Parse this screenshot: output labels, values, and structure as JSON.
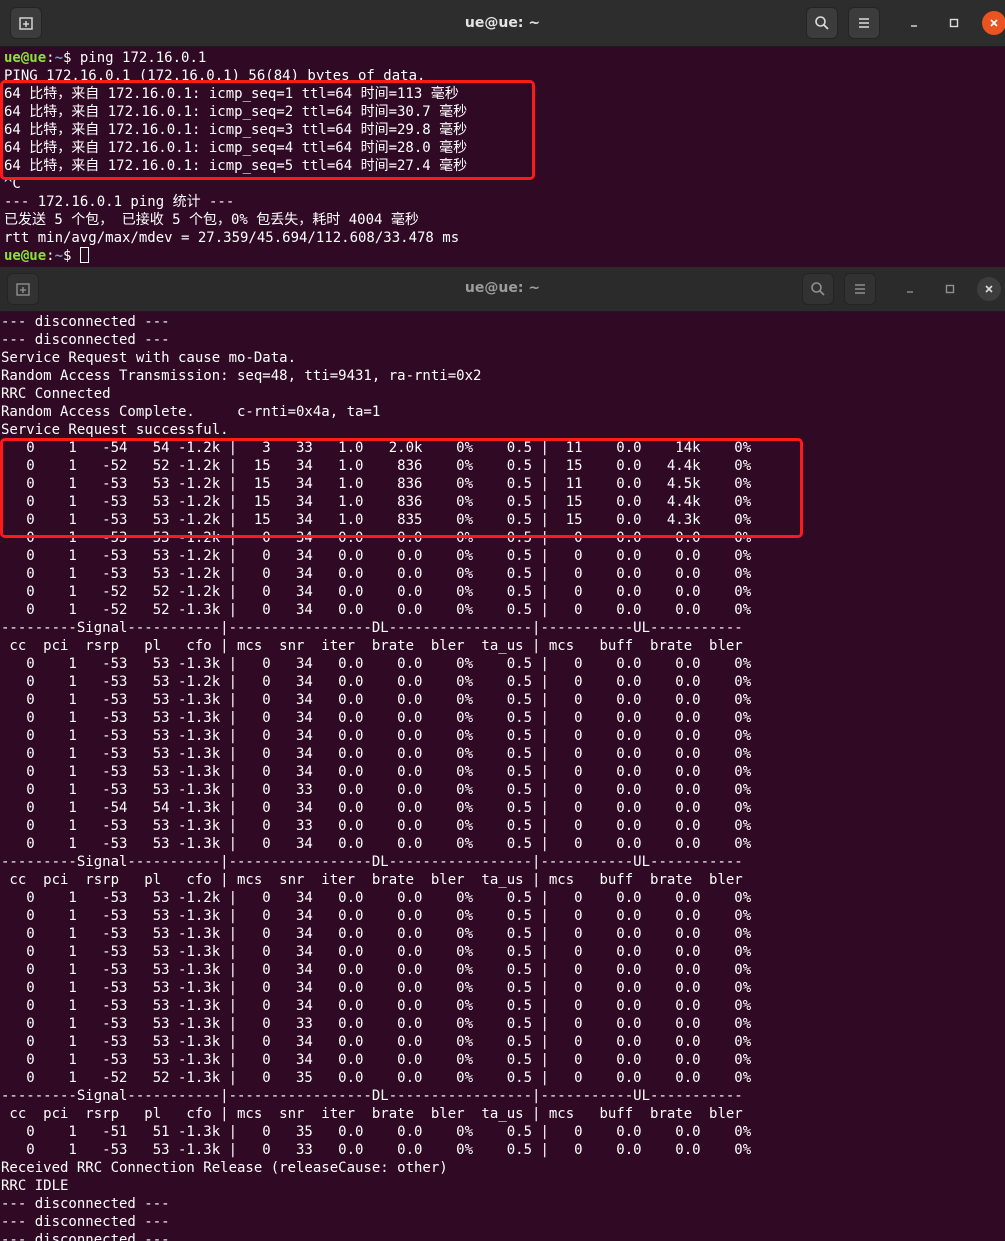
{
  "window1": {
    "title": "ue@ue: ~",
    "prompt_user": "ue@ue",
    "prompt_sep": ":",
    "prompt_path": "~",
    "prompt_dollar": "$ ",
    "command": "ping 172.16.0.1",
    "lines": [
      "PING 172.16.0.1 (172.16.0.1) 56(84) bytes of data.",
      "64 比特，来自 172.16.0.1: icmp_seq=1 ttl=64 时间=113 毫秒",
      "64 比特，来自 172.16.0.1: icmp_seq=2 ttl=64 时间=30.7 毫秒",
      "64 比特，来自 172.16.0.1: icmp_seq=3 ttl=64 时间=29.8 毫秒",
      "64 比特，来自 172.16.0.1: icmp_seq=4 ttl=64 时间=28.0 毫秒",
      "64 比特，来自 172.16.0.1: icmp_seq=5 ttl=64 时间=27.4 毫秒",
      "^C",
      "--- 172.16.0.1 ping 统计 ---",
      "已发送 5 个包， 已接收 5 个包，0% 包丢失，耗时 4004 毫秒",
      "rtt min/avg/max/mdev = 27.359/45.694/112.608/33.478 ms"
    ]
  },
  "window2": {
    "title": "ue@ue: ~",
    "lines": [
      "--- disconnected ---",
      "--- disconnected ---",
      "Service Request with cause mo-Data.",
      "Random Access Transmission: seq=48, tti=9431, ra-rnti=0x2",
      "RRC Connected",
      "Random Access Complete.     c-rnti=0x4a, ta=1",
      "Service Request successful.",
      "   0    1   -54   54 -1.2k |   3   33   1.0   2.0k    0%    0.5 |  11    0.0    14k    0%",
      "   0    1   -52   52 -1.2k |  15   34   1.0    836    0%    0.5 |  15    0.0   4.4k    0%",
      "   0    1   -53   53 -1.2k |  15   34   1.0    836    0%    0.5 |  11    0.0   4.5k    0%",
      "   0    1   -53   53 -1.2k |  15   34   1.0    836    0%    0.5 |  15    0.0   4.4k    0%",
      "   0    1   -53   53 -1.2k |  15   34   1.0    835    0%    0.5 |  15    0.0   4.3k    0%",
      "   0    1   -53   53 -1.2k |   0   34   0.0    0.0    0%    0.5 |   0    0.0    0.0    0%",
      "   0    1   -53   53 -1.2k |   0   34   0.0    0.0    0%    0.5 |   0    0.0    0.0    0%",
      "   0    1   -53   53 -1.2k |   0   34   0.0    0.0    0%    0.5 |   0    0.0    0.0    0%",
      "   0    1   -52   52 -1.2k |   0   34   0.0    0.0    0%    0.5 |   0    0.0    0.0    0%",
      "   0    1   -52   52 -1.3k |   0   34   0.0    0.0    0%    0.5 |   0    0.0    0.0    0%",
      "---------Signal-----------|-----------------DL-----------------|-----------UL-----------",
      " cc  pci  rsrp   pl   cfo | mcs  snr  iter  brate  bler  ta_us | mcs   buff  brate  bler",
      "   0    1   -53   53 -1.3k |   0   34   0.0    0.0    0%    0.5 |   0    0.0    0.0    0%",
      "   0    1   -53   53 -1.2k |   0   34   0.0    0.0    0%    0.5 |   0    0.0    0.0    0%",
      "   0    1   -53   53 -1.3k |   0   34   0.0    0.0    0%    0.5 |   0    0.0    0.0    0%",
      "   0    1   -53   53 -1.3k |   0   34   0.0    0.0    0%    0.5 |   0    0.0    0.0    0%",
      "   0    1   -53   53 -1.3k |   0   34   0.0    0.0    0%    0.5 |   0    0.0    0.0    0%",
      "   0    1   -53   53 -1.3k |   0   34   0.0    0.0    0%    0.5 |   0    0.0    0.0    0%",
      "   0    1   -53   53 -1.3k |   0   34   0.0    0.0    0%    0.5 |   0    0.0    0.0    0%",
      "   0    1   -53   53 -1.3k |   0   33   0.0    0.0    0%    0.5 |   0    0.0    0.0    0%",
      "   0    1   -54   54 -1.3k |   0   34   0.0    0.0    0%    0.5 |   0    0.0    0.0    0%",
      "   0    1   -53   53 -1.3k |   0   33   0.0    0.0    0%    0.5 |   0    0.0    0.0    0%",
      "   0    1   -53   53 -1.3k |   0   34   0.0    0.0    0%    0.5 |   0    0.0    0.0    0%",
      "---------Signal-----------|-----------------DL-----------------|-----------UL-----------",
      " cc  pci  rsrp   pl   cfo | mcs  snr  iter  brate  bler  ta_us | mcs   buff  brate  bler",
      "   0    1   -53   53 -1.2k |   0   34   0.0    0.0    0%    0.5 |   0    0.0    0.0    0%",
      "   0    1   -53   53 -1.3k |   0   34   0.0    0.0    0%    0.5 |   0    0.0    0.0    0%",
      "   0    1   -53   53 -1.3k |   0   34   0.0    0.0    0%    0.5 |   0    0.0    0.0    0%",
      "   0    1   -53   53 -1.3k |   0   34   0.0    0.0    0%    0.5 |   0    0.0    0.0    0%",
      "   0    1   -53   53 -1.3k |   0   34   0.0    0.0    0%    0.5 |   0    0.0    0.0    0%",
      "   0    1   -53   53 -1.3k |   0   34   0.0    0.0    0%    0.5 |   0    0.0    0.0    0%",
      "   0    1   -53   53 -1.3k |   0   34   0.0    0.0    0%    0.5 |   0    0.0    0.0    0%",
      "   0    1   -53   53 -1.3k |   0   33   0.0    0.0    0%    0.5 |   0    0.0    0.0    0%",
      "   0    1   -53   53 -1.3k |   0   34   0.0    0.0    0%    0.5 |   0    0.0    0.0    0%",
      "   0    1   -53   53 -1.3k |   0   34   0.0    0.0    0%    0.5 |   0    0.0    0.0    0%",
      "   0    1   -52   52 -1.3k |   0   35   0.0    0.0    0%    0.5 |   0    0.0    0.0    0%",
      "---------Signal-----------|-----------------DL-----------------|-----------UL-----------",
      " cc  pci  rsrp   pl   cfo | mcs  snr  iter  brate  bler  ta_us | mcs   buff  brate  bler",
      "   0    1   -51   51 -1.3k |   0   35   0.0    0.0    0%    0.5 |   0    0.0    0.0    0%",
      "   0    1   -53   53 -1.3k |   0   33   0.0    0.0    0%    0.5 |   0    0.0    0.0    0%",
      "Received RRC Connection Release (releaseCause: other)",
      "RRC IDLE",
      "--- disconnected ---",
      "--- disconnected ---",
      "--- disconnected ---"
    ]
  },
  "colors": {
    "terminal_bg": "#300a24",
    "prompt_user": "#8ae234",
    "prompt_path": "#729fcf",
    "highlight_border": "#ff1a1a",
    "close_button_active": "#e95420"
  },
  "icons": {
    "new_tab": "new-tab-icon",
    "search": "search-icon",
    "menu": "hamburger-menu-icon",
    "minimize": "minimize-icon",
    "maximize": "maximize-icon",
    "close": "close-icon"
  }
}
